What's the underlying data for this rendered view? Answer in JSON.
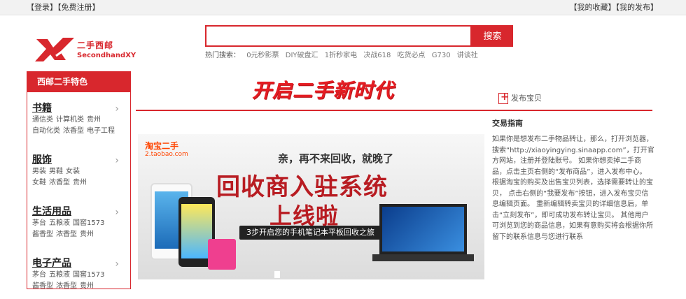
{
  "topbar": {
    "login": "【登录】",
    "register": "【免费注册】",
    "favorites": "【我的收藏】",
    "my_posts": "【我的发布】"
  },
  "logo": {
    "cn": "二手西邮",
    "en": "SecondhandXY"
  },
  "search": {
    "value": "",
    "placeholder": "",
    "button_label": "搜索"
  },
  "hot_search": {
    "label": "热门搜索：",
    "keywords": [
      "0元秒影票",
      "DIY破盘汇",
      "1折秒家电",
      "决战618",
      "吃货必点",
      "G730",
      "讲谈社"
    ]
  },
  "sidebar": {
    "header": "西邮二手特色",
    "categories": [
      {
        "title": "书籍",
        "rows": [
          [
            "通信类",
            "计算机类",
            "贵州"
          ],
          [
            "自动化类",
            "浓香型",
            "电子工程"
          ]
        ]
      },
      {
        "title": "服饰",
        "rows": [
          [
            "男装",
            "男鞋",
            "女装"
          ],
          [
            "女鞋",
            "浓香型",
            "贵州"
          ]
        ]
      },
      {
        "title": "生活用品",
        "rows": [
          [
            "茅台",
            "五粮液",
            "国窖1573"
          ],
          [
            "酱香型",
            "浓香型",
            "贵州"
          ]
        ]
      },
      {
        "title": "电子产品",
        "rows": [
          [
            "茅台",
            "五粮液",
            "国窖1573"
          ],
          [
            "酱香型",
            "浓香型",
            "贵州"
          ]
        ]
      }
    ]
  },
  "slogan": "开启二手新时代",
  "publish_label": "发布宝贝",
  "banner": {
    "brand": "淘宝二手",
    "brand_sub": "2.taobao.com",
    "tagline": "亲，再不来回收，就晚了",
    "headline1": "回收商入驻系统",
    "headline2": "上线啦",
    "pill": "3步开启您的手机笔记本平板回收之旅"
  },
  "guide": {
    "title": "交易指南",
    "text": "如果你是想发布二手物品转让，那么，打开浏览器，搜索“http://xiaoyingying.sinaapp.com”，打开官方网站，注册并登陆账号。 如果你想卖掉二手商品，点击主页右侧的“发布商品”，进入发布中心。 根据淘宝的购买及出售宝贝列表，选择需要转让的宝贝， 点击右侧的“我要发布”按钮，进入发布宝贝信息编辑页面。 重新编辑转卖宝贝的详细信息后，单击“立刻发布”，即可成功发布转让宝贝。 其他用户可浏览到您的商品信息，如果有意购买将会根据你所留下的联系信息与您进行联系"
  },
  "colors": {
    "accent": "#d8272d"
  }
}
